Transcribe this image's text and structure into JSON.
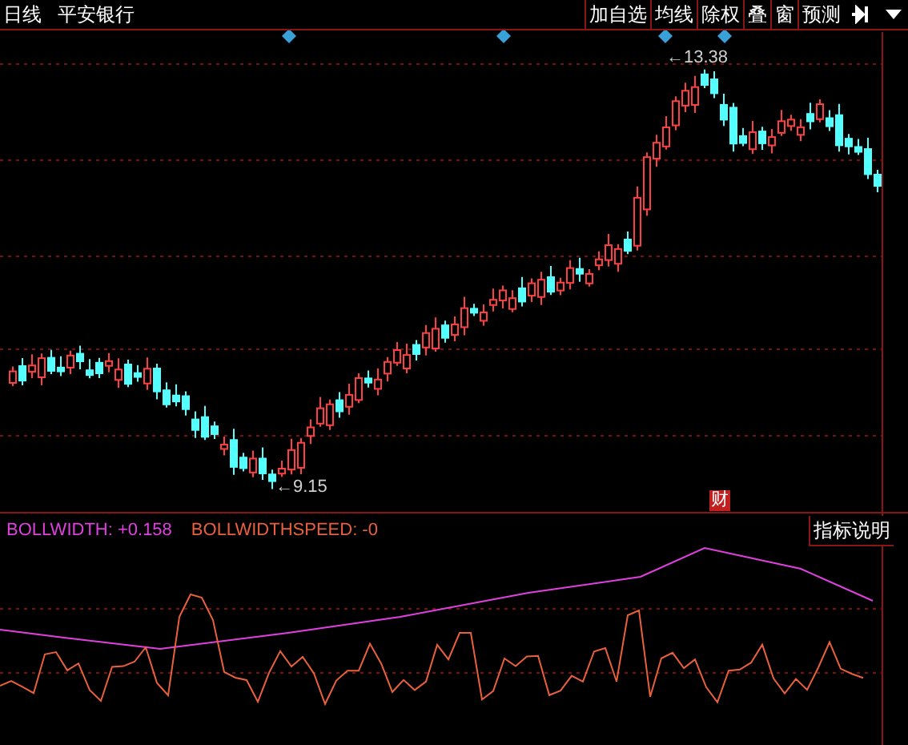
{
  "top_bar": {
    "period": "日线",
    "stock_name": "平安银行",
    "buttons": [
      "加自选",
      "均线",
      "除权",
      "叠",
      "窗",
      "预测"
    ]
  },
  "price_chart": {
    "high_label": "←13.38",
    "low_label": "←9.15",
    "event_badge": "财"
  },
  "indicator": {
    "items": [
      {
        "text": "BOLLWIDTH: +0.158",
        "color": "#e040e0"
      },
      {
        "text": "BOLLWIDTHSPEED: -0",
        "color": "#e8603c"
      }
    ],
    "help_button": "指标说明"
  }
}
